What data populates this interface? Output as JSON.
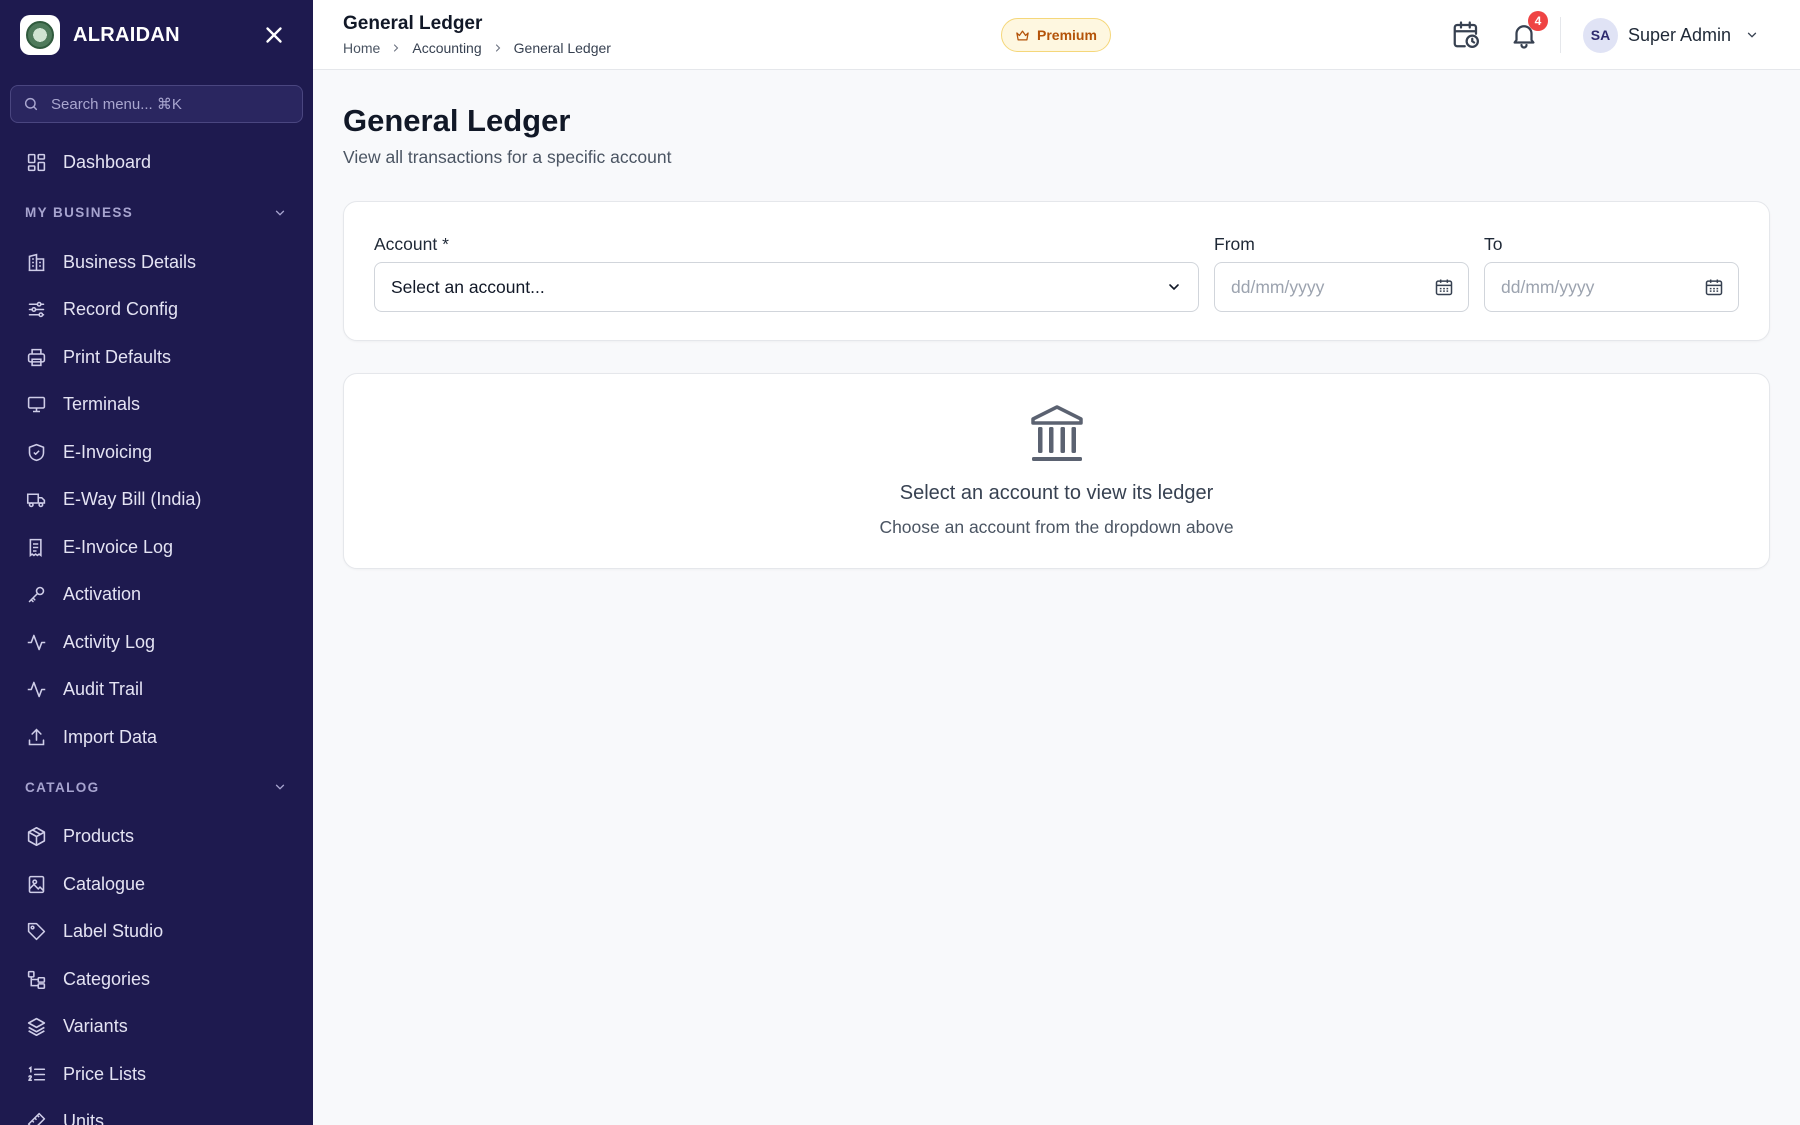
{
  "app": {
    "brand_name": "ALRAIDAN"
  },
  "sidebar": {
    "search_placeholder": "Search menu... ⌘K",
    "dashboard": {
      "label": "Dashboard",
      "icon": "dashboard-icon"
    },
    "sections": [
      {
        "title": "MY BUSINESS",
        "items": [
          {
            "label": "Business Details",
            "icon": "building-icon"
          },
          {
            "label": "Record Config",
            "icon": "sliders-icon"
          },
          {
            "label": "Print Defaults",
            "icon": "printer-icon"
          },
          {
            "label": "Terminals",
            "icon": "monitor-icon"
          },
          {
            "label": "E-Invoicing",
            "icon": "shield-check-icon"
          },
          {
            "label": "E-Way Bill (India)",
            "icon": "truck-icon"
          },
          {
            "label": "E-Invoice Log",
            "icon": "receipt-icon"
          },
          {
            "label": "Activation",
            "icon": "key-icon"
          },
          {
            "label": "Activity Log",
            "icon": "activity-icon"
          },
          {
            "label": "Audit Trail",
            "icon": "activity-icon"
          },
          {
            "label": "Import Data",
            "icon": "upload-icon"
          }
        ]
      },
      {
        "title": "CATALOG",
        "items": [
          {
            "label": "Products",
            "icon": "package-icon"
          },
          {
            "label": "Catalogue",
            "icon": "image-book-icon"
          },
          {
            "label": "Label Studio",
            "icon": "tag-icon"
          },
          {
            "label": "Categories",
            "icon": "hierarchy-icon"
          },
          {
            "label": "Variants",
            "icon": "layers-icon"
          },
          {
            "label": "Price Lists",
            "icon": "list-ordered-icon"
          },
          {
            "label": "Units",
            "icon": "ruler-icon"
          }
        ]
      }
    ]
  },
  "topbar": {
    "title": "General Ledger",
    "breadcrumb": [
      "Home",
      "Accounting",
      "General Ledger"
    ],
    "premium_label": "Premium",
    "notification_count": "4",
    "user": {
      "initials": "SA",
      "name": "Super Admin"
    }
  },
  "main": {
    "title": "General Ledger",
    "subtitle": "View all transactions for a specific account",
    "filters": {
      "account_label": "Account *",
      "account_value": "Select an account...",
      "from_label": "From",
      "from_placeholder": "dd/mm/yyyy",
      "to_label": "To",
      "to_placeholder": "dd/mm/yyyy"
    },
    "empty_state": {
      "icon": "bank-icon",
      "title": "Select an account to view its ledger",
      "subtitle": "Choose an account from the dropdown above"
    }
  },
  "colors": {
    "sidebar_bg": "#1e1a4f",
    "premium_text": "#b45309",
    "badge": "#ef4444"
  }
}
